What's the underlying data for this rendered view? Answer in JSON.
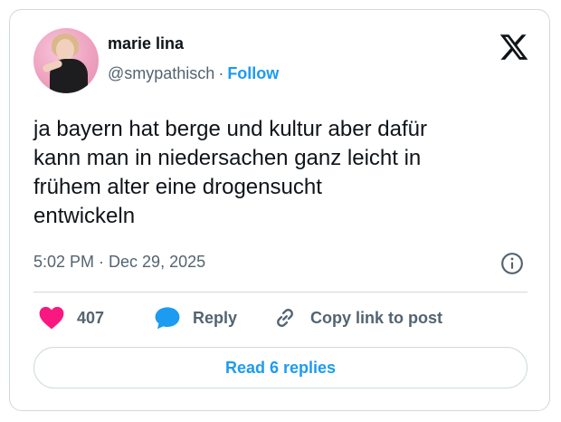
{
  "author": {
    "name": "marie lina",
    "handle": "@smypathisch",
    "separator": "·",
    "follow_label": "Follow",
    "avatar_icon": "profile-photo"
  },
  "logo_icon": "x-logo",
  "tweet": {
    "lines": [
      "ja bayern hat berge und kultur aber dafür",
      "kann man in niedersachen ganz leicht in",
      "frühem alter eine drogensucht",
      "entwickeln"
    ],
    "timestamp": "5:02 PM · Dec 29, 2025"
  },
  "actions": {
    "like_count": "407",
    "reply_label": "Reply",
    "copy_link_label": "Copy link to post"
  },
  "read_replies_label": "Read 6 replies",
  "colors": {
    "accent": "#1d9bf0",
    "like": "#f91880",
    "text": "#0f1419",
    "muted": "#536471",
    "border": "#cfd9de"
  }
}
